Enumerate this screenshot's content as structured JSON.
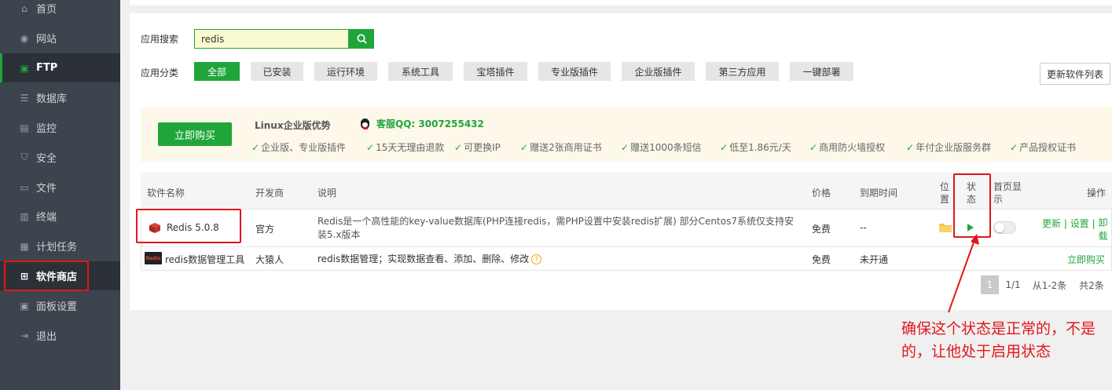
{
  "sidebar": {
    "items": [
      {
        "label": "首页",
        "icon": "home-icon"
      },
      {
        "label": "网站",
        "icon": "globe-icon"
      },
      {
        "label": "FTP",
        "icon": "ftp-icon"
      },
      {
        "label": "数据库",
        "icon": "database-icon"
      },
      {
        "label": "监控",
        "icon": "monitor-icon"
      },
      {
        "label": "安全",
        "icon": "shield-icon"
      },
      {
        "label": "文件",
        "icon": "folder-icon"
      },
      {
        "label": "终端",
        "icon": "terminal-icon"
      },
      {
        "label": "计划任务",
        "icon": "calendar-icon"
      },
      {
        "label": "软件商店",
        "icon": "grid-icon"
      },
      {
        "label": "面板设置",
        "icon": "settings-icon"
      },
      {
        "label": "退出",
        "icon": "logout-icon"
      }
    ]
  },
  "search": {
    "label": "应用搜索",
    "value": "redis"
  },
  "categories": {
    "label": "应用分类",
    "items": [
      "全部",
      "已安装",
      "运行环境",
      "系统工具",
      "宝塔插件",
      "专业版插件",
      "企业版插件",
      "第三方应用",
      "一键部署"
    ]
  },
  "update_button": "更新软件列表",
  "promo": {
    "buy_label": "立即购买",
    "title": "Linux企业版优势",
    "qq": "客服QQ: 3007255432",
    "features": [
      "企业版、专业版插件",
      "15天无理由退款",
      "可更换IP",
      "赠送2张商用证书",
      "赠送1000条短信",
      "低至1.86元/天",
      "商用防火墙授权",
      "年付企业版服务群",
      "产品授权证书"
    ]
  },
  "table": {
    "headers": {
      "name": "软件名称",
      "developer": "开发商",
      "description": "说明",
      "price": "价格",
      "expire": "到期时间",
      "location_1": "位",
      "location_2": "置",
      "status_1": "状",
      "status_2": "态",
      "home_1": "首页显",
      "home_2": "示",
      "actions": "操作"
    },
    "rows": [
      {
        "name": "Redis 5.0.8",
        "developer": "官方",
        "description": "Redis是一个高性能的key-value数据库(PHP连接redis，需PHP设置中安装redis扩展) 部分Centos7系统仅支持安装5.x版本",
        "price": "免费",
        "expire": "--",
        "action_update": "更新",
        "action_settings": "设置",
        "action_uninstall": "卸载",
        "sep": "|"
      },
      {
        "name": "redis数据管理工具",
        "developer": "大猿人",
        "description": "redis数据管理；实现数据查看、添加、删除、修改",
        "price": "免费",
        "expire": "未开通",
        "action_buy": "立即购买",
        "help": "?",
        "icon_text": "Redis"
      }
    ]
  },
  "pagination": {
    "current": "1",
    "pages": "1/1",
    "range": "从1-2条",
    "total": "共2条"
  },
  "annotation": {
    "text": "确保这个状态是正常的，不是的，让他处于启用状态"
  },
  "colors": {
    "accent": "#20a53a",
    "sidebar": "#3c444d",
    "annotation": "#e0171c",
    "promo_bg": "#fdf8ea"
  }
}
